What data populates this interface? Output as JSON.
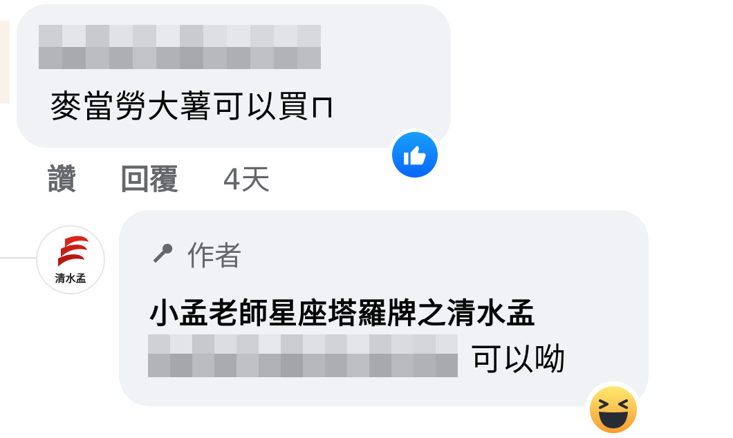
{
  "comment": {
    "text": "麥當勞大薯可以買⊓",
    "reaction": "like-icon",
    "actions": {
      "like": "讚",
      "reply": "回覆",
      "time": "4天"
    }
  },
  "reply": {
    "author_badge": "作者",
    "author_name": "小孟老師星座塔羅牌之清水孟",
    "text": "可以呦",
    "reaction": "haha-icon",
    "avatar_label": "清水孟"
  },
  "colors": {
    "bubble": "#f0f2f5",
    "secondary_text": "#65676b",
    "primary_text": "#050505",
    "like_blue": "#0866ff",
    "haha_yellow": "#f7b928"
  }
}
